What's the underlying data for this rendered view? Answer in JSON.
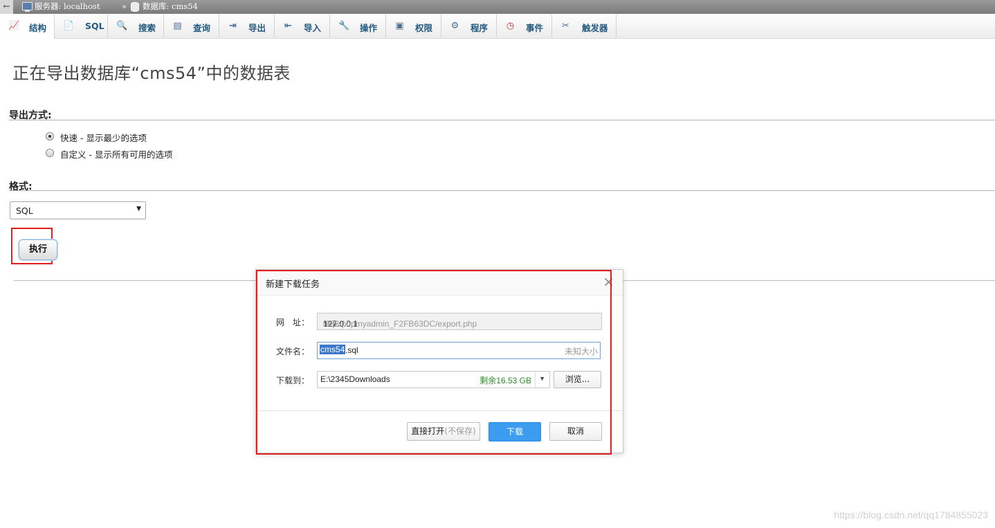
{
  "breadcrumb": {
    "back": "←",
    "server": "服务器: localhost",
    "separator": "»",
    "database": "数据库: cms54"
  },
  "tabs": [
    {
      "label": "结构",
      "icon": "structure-icon"
    },
    {
      "label": "SQL",
      "icon": "sql-icon"
    },
    {
      "label": "搜索",
      "icon": "search-icon"
    },
    {
      "label": "查询",
      "icon": "query-icon"
    },
    {
      "label": "导出",
      "icon": "export-icon"
    },
    {
      "label": "导入",
      "icon": "import-icon"
    },
    {
      "label": "操作",
      "icon": "wrench-icon"
    },
    {
      "label": "权限",
      "icon": "privileges-icon"
    },
    {
      "label": "程序",
      "icon": "routines-icon"
    },
    {
      "label": "事件",
      "icon": "clock-icon"
    },
    {
      "label": "触发器",
      "icon": "triggers-icon"
    }
  ],
  "page_title": "正在导出数据库“cms54”中的数据表",
  "export_method": {
    "title": "导出方式:",
    "options": [
      {
        "label": "快速 - 显示最少的选项",
        "checked": true
      },
      {
        "label": "自定义 - 显示所有可用的选项",
        "checked": false
      }
    ]
  },
  "format": {
    "title": "格式:",
    "selected": "SQL"
  },
  "go_button": "执行",
  "dialog": {
    "title": "新建下载任务",
    "close": "×",
    "url_label": "网　址：",
    "url_prefix": "http://",
    "url_host": "127.0.0.1",
    "url_rest": ":888/phpmyadmin_F2FB63DC/export.php",
    "filename_label": "文件名：",
    "filename_selected": "cms54",
    "filename_ext": ".sql",
    "size": "未知大小",
    "path_label": "下载到：",
    "path": "E:\\2345Downloads",
    "free_space": "剩余16.53 GB",
    "browse": "浏览...",
    "open_direct": "直接打开",
    "open_direct_note": "(不保存)",
    "download": "下载",
    "cancel": "取消"
  },
  "watermark": "https://blog.csdn.net/qq1784855023",
  "colors": {
    "tab_text": "#235a81",
    "highlight": "#e11f1f",
    "download_button": "#3b9cf0",
    "free_space_text": "#2a8a2a"
  }
}
